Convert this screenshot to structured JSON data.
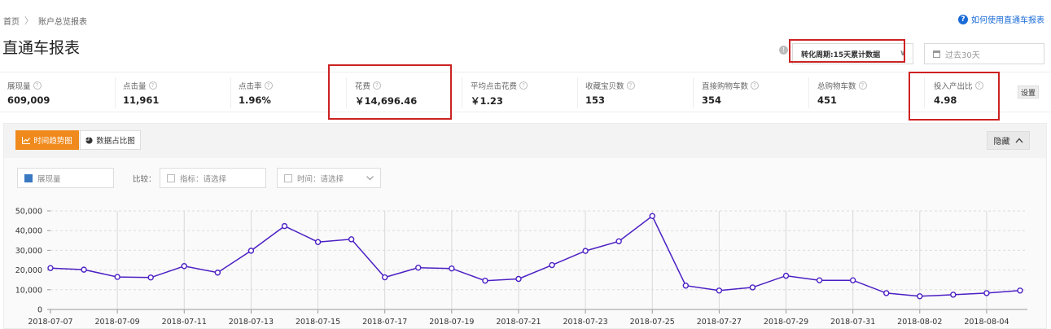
{
  "breadcrumb": {
    "home": "首页",
    "separator": "〉",
    "current": "账户总览报表"
  },
  "help": {
    "icon": "question-icon",
    "label": "如何使用直通车报表"
  },
  "page_title": "直通车报表",
  "filters": {
    "conversion_period": "转化周期:15天累计数据",
    "date_range": "过去30天"
  },
  "metrics": [
    {
      "label": "展现量",
      "value": "609,009"
    },
    {
      "label": "点击量",
      "value": "11,961"
    },
    {
      "label": "点击率",
      "value": "1.96%"
    },
    {
      "label": "花费",
      "value": "￥14,696.46"
    },
    {
      "label": "平均点击花费",
      "value": "￥1.23"
    },
    {
      "label": "收藏宝贝数",
      "value": "153"
    },
    {
      "label": "直接购物车数",
      "value": "354"
    },
    {
      "label": "总购物车数",
      "value": "451"
    },
    {
      "label": "投入产出比",
      "value": "4.98"
    }
  ],
  "settings_label": "设置",
  "panel": {
    "tab_trend": "时间趋势图",
    "tab_pie": "数据占比图",
    "hide_label": "隐藏",
    "series_selector": "展现量",
    "compare_label": "比较：",
    "compare_metric": "指标：请选择",
    "compare_time": "时间：请选择"
  },
  "colors": {
    "accent": "#f08a1c",
    "line": "#4b1fc4",
    "highlight": "#cc2222"
  },
  "chart_data": {
    "type": "line",
    "x": [
      "2018-07-07",
      "2018-07-08",
      "2018-07-09",
      "2018-07-10",
      "2018-07-11",
      "2018-07-12",
      "2018-07-13",
      "2018-07-14",
      "2018-07-15",
      "2018-07-16",
      "2018-07-17",
      "2018-07-18",
      "2018-07-19",
      "2018-07-20",
      "2018-07-21",
      "2018-07-22",
      "2018-07-23",
      "2018-07-24",
      "2018-07-25",
      "2018-07-26",
      "2018-07-27",
      "2018-07-28",
      "2018-07-29",
      "2018-07-30",
      "2018-07-31",
      "2018-08-01",
      "2018-08-02",
      "2018-08-03",
      "2018-08-04",
      "2018-08-05"
    ],
    "x_tick_labels": [
      "2018-07-07",
      "2018-07-09",
      "2018-07-11",
      "2018-07-13",
      "2018-07-15",
      "2018-07-17",
      "2018-07-19",
      "2018-07-21",
      "2018-07-23",
      "2018-07-25",
      "2018-07-27",
      "2018-07-29",
      "2018-07-31",
      "2018-08-02",
      "2018-08-04"
    ],
    "series": [
      {
        "values": [
          21000,
          20200,
          16500,
          16200,
          22000,
          18700,
          29800,
          42300,
          34200,
          35600,
          16300,
          21200,
          20800,
          14600,
          15500,
          22500,
          29700,
          34600,
          47400,
          12100,
          9600,
          11200,
          17100,
          14800,
          14800,
          8300,
          6700,
          7500,
          8300,
          9600
        ]
      }
    ],
    "ylim": [
      0,
      50000
    ],
    "y_ticks": [
      "0",
      "10,000",
      "20,000",
      "30,000",
      "40,000",
      "50,000"
    ],
    "grid": true
  }
}
